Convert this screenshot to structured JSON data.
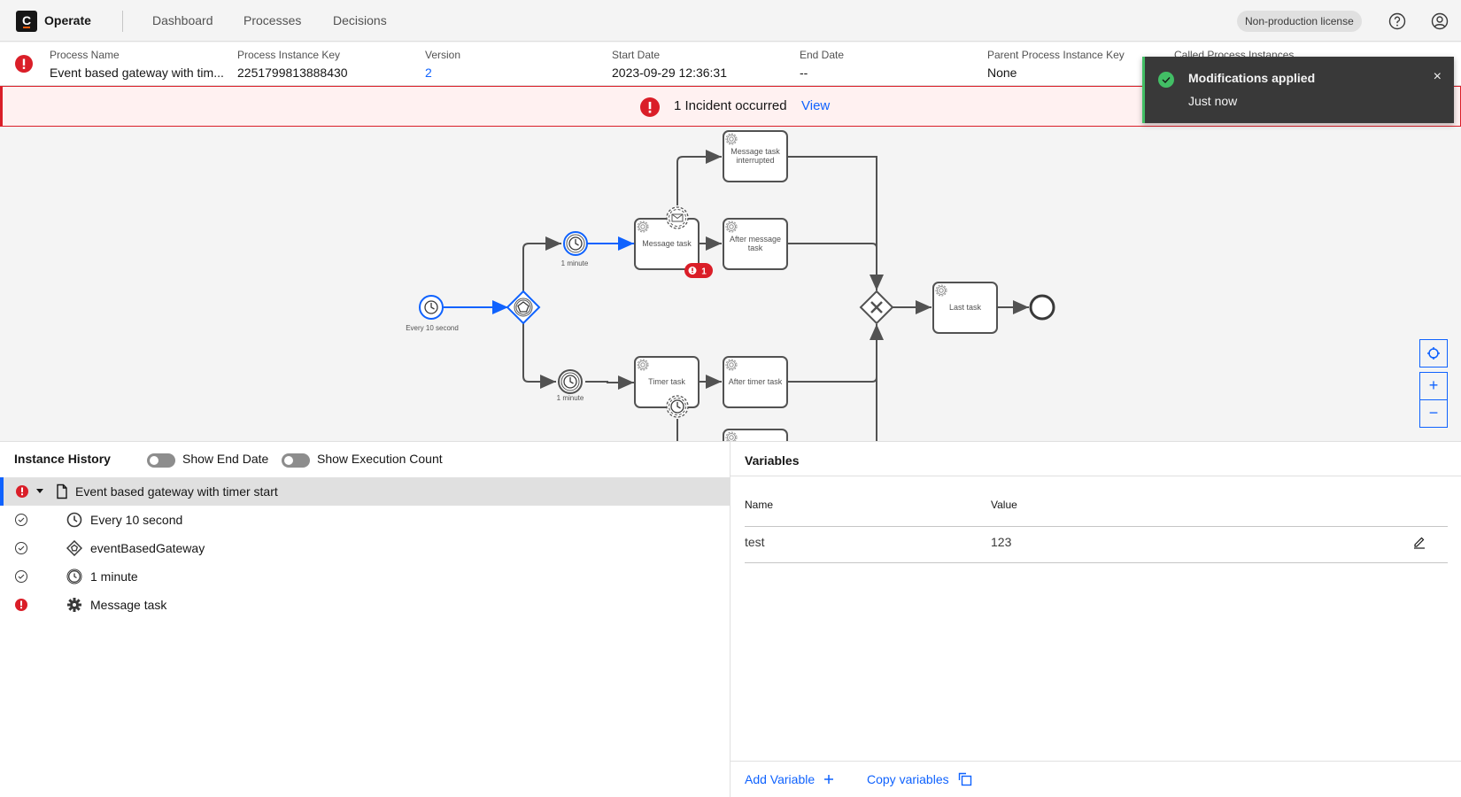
{
  "header": {
    "logo_letter": "C",
    "app_name": "Operate",
    "nav": [
      "Dashboard",
      "Processes",
      "Decisions"
    ],
    "license": "Non-production license",
    "help_icon": "help-icon",
    "user_icon": "user-icon"
  },
  "instance": {
    "status_icon": "incident-icon",
    "columns": [
      {
        "label": "Process Name",
        "value": "Event based gateway with tim..."
      },
      {
        "label": "Process Instance Key",
        "value": "2251799813888430"
      },
      {
        "label": "Version",
        "value": "2"
      },
      {
        "label": "Start Date",
        "value": "2023-09-29 12:36:31"
      },
      {
        "label": "End Date",
        "value": "--"
      },
      {
        "label": "Parent Process Instance Key",
        "value": "None"
      },
      {
        "label": "Called Process Instances",
        "value": ""
      }
    ]
  },
  "incident_banner": {
    "text": "1 Incident occurred",
    "link": "View"
  },
  "toast": {
    "title": "Modifications applied",
    "subtitle": "Just now",
    "close": "×",
    "accent": "#42be65"
  },
  "diagram": {
    "labels": {
      "start": "Every 10 second",
      "timer_top": "1 minute",
      "timer_bottom": "1 minute",
      "message_task": "Message task",
      "message_task_interrupted_1": "Message task",
      "message_task_interrupted_2": "interrupted",
      "after_message_1": "After message",
      "after_message_2": "task",
      "timer_task": "Timer task",
      "after_timer": "After timer task",
      "last_task": "Last task"
    },
    "incident_badge": "1",
    "controls": {
      "reset": "⌖",
      "zoom_in": "+",
      "zoom_out": "−"
    }
  },
  "history": {
    "title": "Instance History",
    "toggles": [
      "Show End Date",
      "Show Execution Count"
    ],
    "rows": [
      {
        "status": "incident",
        "icon": "document-icon",
        "label": "Event based gateway with timer start",
        "selected": true
      },
      {
        "status": "completed",
        "icon": "timer-icon",
        "label": "Every 10 second"
      },
      {
        "status": "completed",
        "icon": "gateway-icon",
        "label": "eventBasedGateway"
      },
      {
        "status": "completed",
        "icon": "timer-intermediate-icon",
        "label": "1 minute"
      },
      {
        "status": "incident",
        "icon": "service-task-icon",
        "label": "Message task"
      }
    ]
  },
  "variables": {
    "title": "Variables",
    "columns": [
      "Name",
      "Value"
    ],
    "rows": [
      {
        "name": "test",
        "value": "123"
      }
    ],
    "add_label": "Add Variable",
    "copy_label": "Copy variables"
  }
}
